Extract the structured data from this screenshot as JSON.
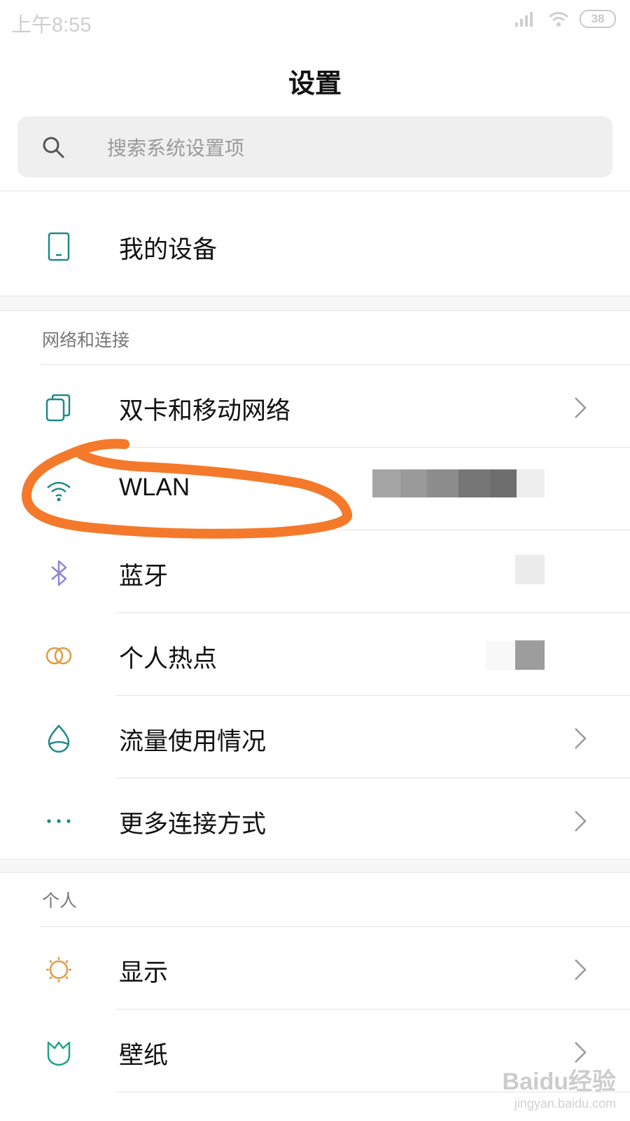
{
  "status_bar": {
    "time": "上午8:55",
    "battery": "38"
  },
  "header": {
    "title": "设置"
  },
  "search": {
    "placeholder": "搜索系统设置项"
  },
  "top_item": {
    "label": "我的设备"
  },
  "sections": {
    "network": {
      "title": "网络和连接",
      "items": [
        {
          "label": "双卡和移动网络",
          "icon": "sim-cards-icon"
        },
        {
          "label": "WLAN",
          "icon": "wifi-icon"
        },
        {
          "label": "蓝牙",
          "icon": "bluetooth-icon"
        },
        {
          "label": "个人热点",
          "icon": "hotspot-icon"
        },
        {
          "label": "流量使用情况",
          "icon": "data-usage-icon"
        },
        {
          "label": "更多连接方式",
          "icon": "more-dots-icon"
        }
      ]
    },
    "personal": {
      "title": "个人",
      "items": [
        {
          "label": "显示",
          "icon": "brightness-icon"
        },
        {
          "label": "壁纸",
          "icon": "wallpaper-icon"
        }
      ]
    }
  },
  "watermark": {
    "brand": "Baidu经验",
    "url": "jingyan.baidu.com"
  },
  "colors": {
    "annotation": "#f4792a",
    "teal_icon": "#1c8a86",
    "bluetooth_icon": "#8b86d6",
    "hotspot_icon": "#e09a45"
  }
}
